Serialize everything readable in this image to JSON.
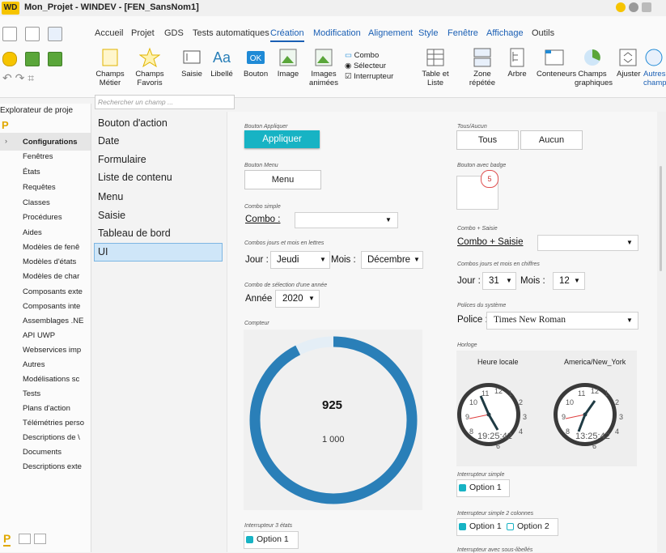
{
  "window": {
    "title": "Mon_Projet - WINDEV - [FEN_SansNom1]",
    "logo": "WD"
  },
  "tabs": [
    "Accueil",
    "Projet",
    "GDS",
    "Tests automatiques",
    "Création",
    "Modification",
    "Alignement",
    "Style",
    "Fenêtre",
    "Affichage",
    "Outils"
  ],
  "ribbon": {
    "champs_metier": "Champs\nMétier",
    "champs_favoris": "Champs\nFavoris",
    "saisie": "Saisie",
    "libelle": "Libellé",
    "bouton": "Bouton",
    "image": "Image",
    "images_animees": "Images\nanimées",
    "combo": "Combo",
    "selecteur": "Sélecteur",
    "interrupteur": "Interrupteur",
    "table_liste": "Table et\nListe",
    "zone_repetee": "Zone\nrépétée",
    "arbre": "Arbre",
    "conteneurs": "Conteneurs",
    "champs_graphiques": "Champs\ngraphiques",
    "ajuster": "Ajuster",
    "autres_champs": "Autres\nchamp"
  },
  "search": {
    "placeholder": "Rechercher un champ ..."
  },
  "explorer": {
    "title": "Explorateur de proje",
    "items": [
      "Configurations",
      "Fenêtres",
      "États",
      "Requêtes",
      "Classes",
      "Procédures",
      "Aides",
      "Modèles de fenê",
      "Modèles d'états",
      "Modèles de char",
      "Composants exte",
      "Composants inte",
      "Assemblages .NE",
      "API UWP",
      "Webservices imp",
      "Autres",
      "Modélisations sc",
      "Tests",
      "Plans d'action",
      "Télémétries perso",
      "Descriptions de \\",
      "Documents",
      "Descriptions exte"
    ]
  },
  "categories": [
    "Bouton d'action",
    "Date",
    "Formulaire",
    "Liste de contenu",
    "Menu",
    "Saisie",
    "Tableau de bord",
    "UI"
  ],
  "canvas": {
    "bouton_appliquer_lbl": "Bouton Appliquer",
    "appliquer": "Appliquer",
    "bouton_menu_lbl": "Bouton Menu",
    "menu": "Menu",
    "combo_simple_lbl": "Combo simple",
    "combo_label": "Combo :",
    "combos_lettres_lbl": "Combos jours et mois en lettres",
    "jour_label": "Jour :",
    "jour_val": "Jeudi",
    "mois_label": "Mois :",
    "mois_val": "Décembre",
    "combo_annee_lbl": "Combo de sélection d'une année",
    "annee_label": "Année :",
    "annee_val": "2020",
    "compteur_lbl": "Compteur",
    "compteur_val": "925",
    "compteur_max": "1 000",
    "compteur_fraction": 0.925,
    "interrupteur3_lbl": "Interrupteur 3 états",
    "option1_a": "Option 1",
    "tous_aucun_lbl": "Tous/Aucun",
    "tous": "Tous",
    "aucun": "Aucun",
    "bouton_badge_lbl": "Bouton avec badge",
    "badge_val": "5",
    "combo_saisie_lbl": "Combo + Saisie",
    "combo_saisie_label": "Combo + Saisie",
    "combos_chiffres_lbl": "Combos jours et mois en chiffres",
    "jour2_label": "Jour :",
    "jour2_val": "31",
    "mois2_label": "Mois :",
    "mois2_val": "12",
    "polices_lbl": "Polices du système",
    "police_label": "Police :",
    "police_val": "Times New Roman",
    "horloge_lbl": "Horloge",
    "heure_locale": "Heure locale",
    "ny": "America/New_York",
    "time1": "19:25:42",
    "time2": "13:25:42",
    "interrupteur_simple_lbl": "Interrupteur simple",
    "option1_b": "Option 1",
    "interrupteur2col_lbl": "Interrupteur simple 2 colonnes",
    "option1_c": "Option 1",
    "option2_c": "Option 2",
    "interrupteur_sous_lbl": "Interrupteur avec sous-libellés"
  },
  "colors": {
    "accent": "#17b3c4",
    "gauge": "#2a7fb8",
    "selection": "#cfe6f8"
  }
}
